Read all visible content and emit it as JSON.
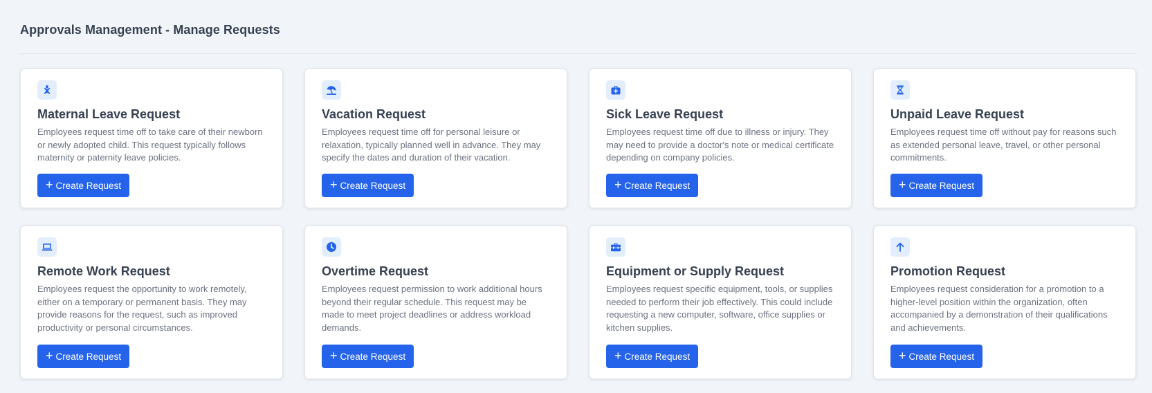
{
  "page": {
    "title": "Approvals Management - Manage Requests"
  },
  "colors": {
    "accent": "#2563eb",
    "icon_bg": "#e3eefc",
    "icon_fg": "#2563eb"
  },
  "cards": [
    {
      "icon": "baby-icon",
      "title": "Maternal Leave Request",
      "description": "Employees request time off to take care of their newborn or newly adopted child. This request typically follows maternity or paternity leave policies.",
      "button_label": "Create Request"
    },
    {
      "icon": "beach-umbrella-icon",
      "title": "Vacation Request",
      "description": "Employees request time off for personal leisure or relaxation, typically planned well in advance. They may specify the dates and duration of their vacation.",
      "button_label": "Create Request"
    },
    {
      "icon": "medical-kit-icon",
      "title": "Sick Leave Request",
      "description": "Employees request time off due to illness or injury. They may need to provide a doctor's note or medical certificate depending on company policies.",
      "button_label": "Create Request"
    },
    {
      "icon": "hourglass-icon",
      "title": "Unpaid Leave Request",
      "description": "Employees request time off without pay for reasons such as extended personal leave, travel, or other personal commitments.",
      "button_label": "Create Request"
    },
    {
      "icon": "laptop-icon",
      "title": "Remote Work Request",
      "description": "Employees request the opportunity to work remotely, either on a temporary or permanent basis. They may provide reasons for the request, such as improved productivity or personal circumstances.",
      "button_label": "Create Request"
    },
    {
      "icon": "clock-icon",
      "title": "Overtime Request",
      "description": "Employees request permission to work additional hours beyond their regular schedule. This request may be made to meet project deadlines or address workload demands.",
      "button_label": "Create Request"
    },
    {
      "icon": "toolbox-icon",
      "title": "Equipment or Supply Request",
      "description": "Employees request specific equipment, tools, or supplies needed to perform their job effectively. This could include requesting a new computer, software, office supplies or kitchen supplies.",
      "button_label": "Create Request"
    },
    {
      "icon": "arrow-up-icon",
      "title": "Promotion Request",
      "description": "Employees request consideration for a promotion to a higher-level position within the organization, often accompanied by a demonstration of their qualifications and achievements.",
      "button_label": "Create Request"
    }
  ]
}
